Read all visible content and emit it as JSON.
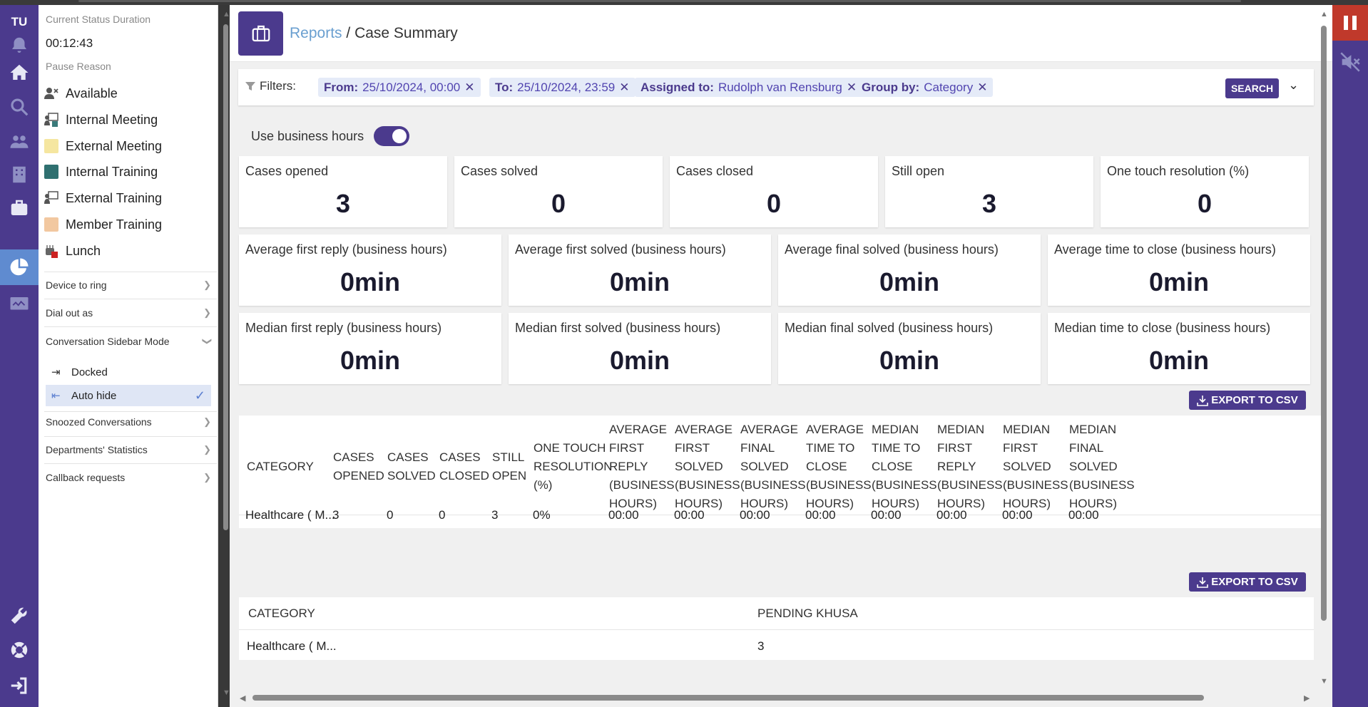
{
  "rail": {
    "initials": "TU"
  },
  "status_panel": {
    "duration_label": "Current Status Duration",
    "duration": "00:12:43",
    "pause_reason_label": "Pause Reason",
    "statuses": [
      {
        "label": "Available",
        "icon": "person-x-icon",
        "color": "#555555"
      },
      {
        "label": "Internal Meeting",
        "icon": "presentation-icon",
        "color": "#3a7a7a"
      },
      {
        "label": "External Meeting",
        "icon": "square-icon",
        "color": "#f5e6a0"
      },
      {
        "label": "Internal Training",
        "icon": "square-icon",
        "color": "#2f7070"
      },
      {
        "label": "External Training",
        "icon": "presentation-icon",
        "color": "#555555"
      },
      {
        "label": "Member Training",
        "icon": "square-icon",
        "color": "#f2c8a0"
      },
      {
        "label": "Lunch",
        "icon": "lunch-icon",
        "color": "#cc2222"
      }
    ],
    "menu": {
      "device_to_ring": "Device to ring",
      "dial_out_as": "Dial out as",
      "sidebar_mode": "Conversation Sidebar Mode",
      "docked": "Docked",
      "auto_hide": "Auto hide",
      "snoozed": "Snoozed Conversations",
      "departments": "Departments' Statistics",
      "callback": "Callback requests"
    }
  },
  "header": {
    "breadcrumb_link": "Reports",
    "breadcrumb_sep": "/",
    "breadcrumb_current": "Case Summary"
  },
  "filters": {
    "label": "Filters:",
    "chips": [
      {
        "key": "From:",
        "value": "25/10/2024, 00:00"
      },
      {
        "key": "To:",
        "value": "25/10/2024, 23:59"
      },
      {
        "key": "Assigned to:",
        "value": "Rudolph van Rensburg"
      },
      {
        "key": "Group by:",
        "value": "Category"
      }
    ],
    "search_label": "SEARCH"
  },
  "business_hours": {
    "label": "Use business hours",
    "enabled": true
  },
  "summary_cards": [
    {
      "label": "Cases opened",
      "value": "3"
    },
    {
      "label": "Cases solved",
      "value": "0"
    },
    {
      "label": "Cases closed",
      "value": "0"
    },
    {
      "label": "Still open",
      "value": "3"
    },
    {
      "label": "One touch resolution (%)",
      "value": "0"
    }
  ],
  "average_cards": [
    {
      "label": "Average first reply (business hours)",
      "value": "0min"
    },
    {
      "label": "Average first solved (business hours)",
      "value": "0min"
    },
    {
      "label": "Average final solved (business hours)",
      "value": "0min"
    },
    {
      "label": "Average time to close (business hours)",
      "value": "0min"
    }
  ],
  "median_cards": [
    {
      "label": "Median first reply (business hours)",
      "value": "0min"
    },
    {
      "label": "Median first solved (business hours)",
      "value": "0min"
    },
    {
      "label": "Median final solved (business hours)",
      "value": "0min"
    },
    {
      "label": "Median time to close (business hours)",
      "value": "0min"
    }
  ],
  "export_label": "EXPORT TO CSV",
  "table1": {
    "headers": [
      [
        "CATEGORY"
      ],
      [
        "CASES",
        "OPENED"
      ],
      [
        "CASES",
        "SOLVED"
      ],
      [
        "CASES",
        "CLOSED"
      ],
      [
        "STILL",
        "OPEN"
      ],
      [
        "ONE TOUCH",
        "RESOLUTION",
        "(%)"
      ],
      [
        "AVERAGE",
        "FIRST",
        "REPLY",
        "(BUSINESS",
        "HOURS)"
      ],
      [
        "AVERAGE",
        "FIRST",
        "SOLVED",
        "(BUSINESS",
        "HOURS)"
      ],
      [
        "AVERAGE",
        "FINAL",
        "SOLVED",
        "(BUSINESS",
        "HOURS)"
      ],
      [
        "AVERAGE",
        "TIME TO",
        "CLOSE",
        "(BUSINESS",
        "HOURS)"
      ],
      [
        "MEDIAN",
        "TIME TO",
        "CLOSE",
        "(BUSINESS",
        "HOURS)"
      ],
      [
        "MEDIAN",
        "FIRST",
        "REPLY",
        "(BUSINESS",
        "HOURS)"
      ],
      [
        "MEDIAN",
        "FIRST",
        "SOLVED",
        "(BUSINESS",
        "HOURS)"
      ],
      [
        "MEDIAN",
        "FINAL",
        "SOLVED",
        "(BUSINESS",
        "HOURS)"
      ]
    ],
    "rows": [
      [
        "Healthcare ( M...",
        "3",
        "0",
        "0",
        "3",
        "0%",
        "00:00",
        "00:00",
        "00:00",
        "00:00",
        "00:00",
        "00:00",
        "00:00",
        "00:00"
      ]
    ]
  },
  "table2": {
    "headers": [
      "CATEGORY",
      "PENDING KHUSA"
    ],
    "rows": [
      [
        "Healthcare ( M...",
        "3"
      ]
    ]
  },
  "colors": {
    "brand": "#4b3a8d",
    "accent": "#6a9fd0",
    "pause": "#c0392b"
  }
}
